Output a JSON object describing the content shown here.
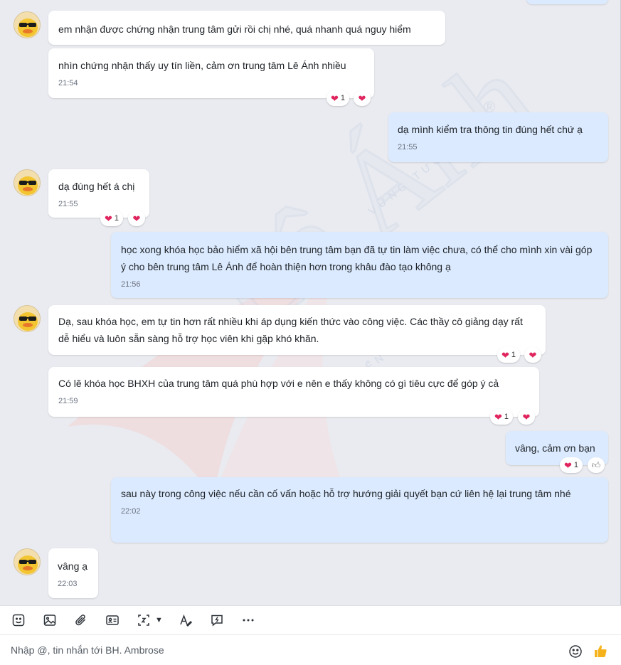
{
  "watermark": {
    "brand": "Lê Ánh",
    "mark": "®",
    "tagline": "TRAO KIẾN THỨC",
    "sub": "VỮNG TƯƠNG LAI"
  },
  "messages": [
    {
      "id": "m1",
      "side": "in",
      "text": "em nhận được chứng nhận trung tâm gửi rồi chị nhé, quá nhanh quá nguy hiểm",
      "time": ""
    },
    {
      "id": "m2",
      "side": "in",
      "text": "nhìn chứng nhận thấy uy tín liền, cảm ơn trung tâm Lê Ánh nhiều",
      "time": "21:54",
      "reaction_count": "1"
    },
    {
      "id": "m3",
      "side": "out",
      "text": "dạ mình kiểm tra thông tin đúng hết chứ ạ",
      "time": "21:55"
    },
    {
      "id": "m4",
      "side": "in",
      "text": "dạ đúng hết á chị",
      "time": "21:55",
      "reaction_count": "1"
    },
    {
      "id": "m5",
      "side": "out",
      "text": "học xong khóa học bảo hiểm xã hội bên trung tâm bạn đã tự tin làm việc chưa, có thể cho mình xin vài góp ý cho bên trung tâm Lê Ánh để hoàn thiện hơn trong khâu đào tạo không ạ",
      "time": "21:56"
    },
    {
      "id": "m6",
      "side": "in",
      "text": "Dạ, sau khóa học, em tự tin hơn rất nhiều khi áp dụng kiến thức vào công việc. Các thầy cô giảng dạy rất dễ hiểu và luôn sẵn sàng hỗ trợ học viên khi gặp khó khăn.",
      "time": "",
      "reaction_count": "1"
    },
    {
      "id": "m7",
      "side": "in",
      "text": "Có lẽ khóa học BHXH của trung tâm quá phù hợp với e nên e thấy không có gì tiêu cực để góp ý cả",
      "time": "21:59",
      "reaction_count": "1"
    },
    {
      "id": "m8",
      "side": "out",
      "text": "vâng, cảm ơn bạn",
      "time": "",
      "reaction_count": "1"
    },
    {
      "id": "m9",
      "side": "out",
      "text": "sau này trong công việc nếu cần cố vấn hoặc hỗ trợ hướng giải quyết bạn cứ liên hệ lại trung tâm nhé",
      "time": "22:02"
    },
    {
      "id": "m10",
      "side": "in",
      "text": "vâng ạ",
      "time": "22:03"
    }
  ],
  "toolbar": {
    "items": [
      "sticker-icon",
      "image-icon",
      "attachment-icon",
      "contact-card-icon",
      "screenshot-icon",
      "format-text-icon",
      "quick-message-icon",
      "more-icon"
    ]
  },
  "composer": {
    "placeholder": "Nhập @, tin nhắn tới BH. Ambrose"
  },
  "colors": {
    "incoming": "#ffffff",
    "outgoing": "#dbeafe",
    "background": "#e9ebf0",
    "heart": "#e0245e",
    "like": "#f5b21b"
  }
}
